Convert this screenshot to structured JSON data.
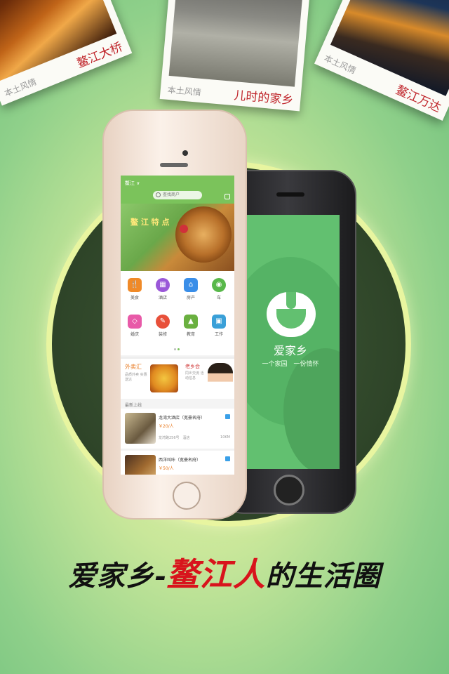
{
  "photos": [
    {
      "tag": "本土风情",
      "caption": "鳌江大桥"
    },
    {
      "tag": "本土风情",
      "caption": "儿时的家乡"
    },
    {
      "tag": "本土风情",
      "caption": "鳌江万达"
    }
  ],
  "app": {
    "city": "鳌江 ∨",
    "search_placeholder": "查找商户",
    "banner_text": "鳌 江 特 点",
    "categories": [
      {
        "label": "美食",
        "color": "#f08a28",
        "glyph": "🍴"
      },
      {
        "label": "酒店",
        "color": "#9a58d8",
        "glyph": "▦"
      },
      {
        "label": "房产",
        "color": "#3a8ee8",
        "glyph": "⌂"
      },
      {
        "label": "车",
        "color": "#58b84a",
        "glyph": "◉"
      },
      {
        "label": "婚庆",
        "color": "#e85aa8",
        "glyph": "◇"
      },
      {
        "label": "装修",
        "color": "#e8503a",
        "glyph": "✎"
      },
      {
        "label": "教育",
        "color": "#6ab040",
        "glyph": "▲"
      },
      {
        "label": "工作",
        "color": "#3aa0d8",
        "glyph": "▣"
      }
    ],
    "promo": {
      "title": "外卖汇",
      "sub": "品质外卖 实惠送达",
      "title2": "老乡会",
      "sub2": "同乡交流 活动信息"
    },
    "section_title": "最新上线",
    "listings": [
      {
        "name": "龙湾大酒店（宽豪名府）",
        "price": "￥20/人",
        "addr": "龙湾路256号　酒店",
        "dist": "10KM"
      },
      {
        "name": "西洋叫咔（宽豪名府）",
        "price": "￥50/人",
        "addr": "",
        "dist": ""
      }
    ]
  },
  "splash": {
    "name": "爱家乡",
    "slogan": "一个家园　一份情怀"
  },
  "slogan": {
    "part1": "爱家乡-",
    "part2": "鳌江人",
    "part3": "的生活圈"
  },
  "colors": {
    "accent_green": "#62c070",
    "caption_red": "#c0262c",
    "slogan_red": "#d8141c"
  }
}
